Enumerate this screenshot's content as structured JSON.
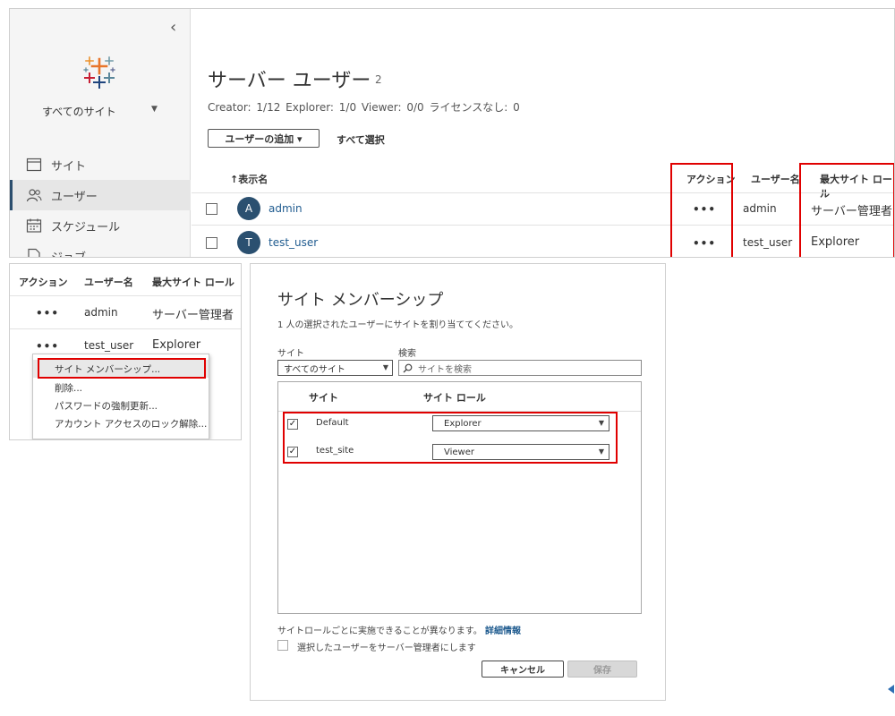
{
  "top": {
    "sidebar": {
      "collapse_glyph": "‹",
      "site_selector": "すべてのサイト",
      "caret": "▼",
      "items": [
        {
          "label": "サイト",
          "icon": "site-icon"
        },
        {
          "label": "ユーザー",
          "icon": "users-icon",
          "active": true
        },
        {
          "label": "スケジュール",
          "icon": "calendar-icon"
        },
        {
          "label": "ジョブ",
          "icon": "job-icon"
        }
      ]
    },
    "main": {
      "title": "サーバー ユーザー",
      "count": "2",
      "license_stats": "Creator: 1/12   Explorer: 1/0   Viewer: 0/0   ライセンスなし: 0",
      "add_user_button": "ユーザーの追加 ▾",
      "select_all": "すべて選択",
      "columns": {
        "display_name": "↑表示名",
        "action": "アクション",
        "username": "ユーザー名",
        "max_site_role": "最大サイト ロール"
      },
      "rows": [
        {
          "initial": "A",
          "display_name": "admin",
          "action": "•••",
          "username": "admin",
          "role": "サーバー管理者"
        },
        {
          "initial": "T",
          "display_name": "test_user",
          "action": "•••",
          "username": "test_user",
          "role": "Explorer"
        }
      ]
    }
  },
  "menu_shot": {
    "columns": {
      "action": "アクション",
      "username": "ユーザー名",
      "max_site_role": "最大サイト ロール"
    },
    "rows": [
      {
        "action": "•••",
        "username": "admin",
        "role": "サーバー管理者"
      },
      {
        "action": "•••",
        "username": "test_user",
        "role": "Explorer"
      }
    ],
    "context_menu": [
      "サイト メンバーシップ...",
      "削除...",
      "パスワードの強制更新...",
      "アカウント アクセスのロック解除..."
    ]
  },
  "dialog": {
    "title": "サイト メンバーシップ",
    "description": "1 人の選択されたユーザーにサイトを割り当ててください。",
    "site_label": "サイト",
    "site_value": "すべてのサイト",
    "search_label": "検索",
    "search_placeholder": "サイトを検索",
    "table_headers": {
      "site": "サイト",
      "site_role": "サイト ロール"
    },
    "sites": [
      {
        "checked": "✓",
        "name": "Default",
        "role": "Explorer"
      },
      {
        "checked": "✓",
        "name": "test_site",
        "role": "Viewer"
      }
    ],
    "note": "サイトロールごとに実施できることが異なります。",
    "note_link": "詳細情報",
    "admin_checkbox_label": "選択したユーザーをサーバー管理者にします",
    "cancel_button": "キャンセル",
    "save_button": "保存"
  },
  "colors": {
    "highlight": "#e00000",
    "link": "#1f5b8f",
    "avatar": "#2b5070"
  }
}
